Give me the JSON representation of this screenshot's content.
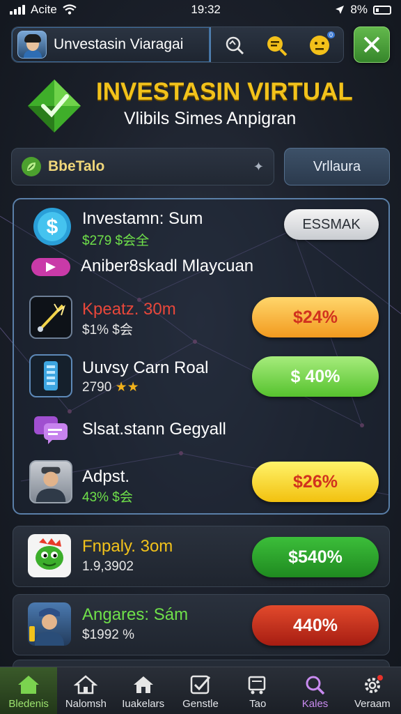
{
  "status_bar": {
    "carrier": "Acite",
    "time": "19:32",
    "battery": "8%"
  },
  "header": {
    "title": "Unvestasin Viaragai",
    "notification_badge": "0"
  },
  "hero": {
    "title": "INVESTASIN VIRTUAL",
    "subtitle": "Vlibils Simes Anpigran"
  },
  "filter": {
    "label": "BbeTalo",
    "view_button": "Vrllaura"
  },
  "panel": {
    "summary_title": "Investamn: Sum",
    "summary_sub": "$279 $会全",
    "summary_button": "ESSMAK",
    "section_heading": "Anibеr8skadl Mlaycuan",
    "items": [
      {
        "title": "Kpeatz. 30m",
        "sub": "$1% $会",
        "pill": "$24%",
        "title_color": "#e8473a"
      },
      {
        "title": "Uuvsy Carn Roal",
        "sub": "2790",
        "pill": "$ 40%",
        "title_color": "#ffffff"
      },
      {
        "title": "Adpst.",
        "sub": "43% $会",
        "pill": "$26%",
        "title_color": "#ffffff"
      }
    ],
    "chat_heading": "Slsat.stann Gegyall"
  },
  "cards": [
    {
      "title": "Fnpaly. 3om",
      "sub": "1.9,3902",
      "pill": "$540%"
    },
    {
      "title": "Angares: Sám",
      "sub": "$1992 %",
      "pill": "440%"
    }
  ],
  "nav": [
    {
      "label": "Bledenis"
    },
    {
      "label": "Nalomsh"
    },
    {
      "label": "Iuakelars"
    },
    {
      "label": "Genstle"
    },
    {
      "label": "Tao"
    },
    {
      "label": "Kales"
    },
    {
      "label": "Veraam"
    }
  ],
  "colors": {
    "accent_gold": "#f2c21b",
    "panel_border": "#5a7fa8",
    "nav_active": "#9de36f"
  }
}
